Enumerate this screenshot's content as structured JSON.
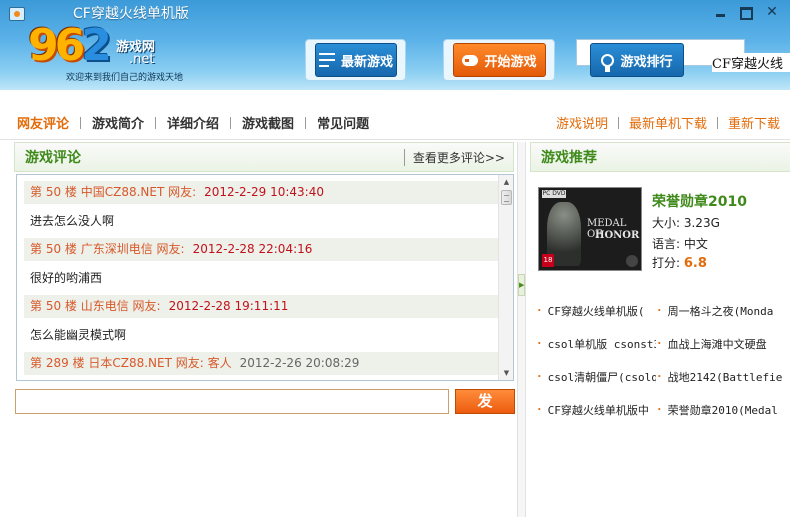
{
  "window": {
    "title": "CF穿越火线单机版"
  },
  "logo": {
    "digits": [
      "9",
      "6",
      "2"
    ],
    "brand_cn": "游戏网",
    "brand_suffix": ".net",
    "slogan": "欢迎来到我们自己的游戏天地"
  },
  "header_buttons": {
    "latest": "最新游戏",
    "start": "开始游戏",
    "ranking": "游戏排行"
  },
  "marquee_text": "CF穿越火线",
  "tabs": [
    "网友评论",
    "游戏简介",
    "详细介绍",
    "游戏截图",
    "常见问题"
  ],
  "links": [
    "游戏说明",
    "最新单机下载",
    "重新下载"
  ],
  "comments_section": {
    "title": "游戏评论",
    "more": "查看更多评论>>",
    "items": [
      {
        "header": "第 50 楼 中国CZ88.NET 网友:",
        "time": "2012-2-29 10:43:40",
        "body": "进去怎么没人啊"
      },
      {
        "header": "第 50 楼 广东深圳电信 网友:",
        "time": "2012-2-28 22:04:16",
        "body": "很好的哟浦西"
      },
      {
        "header": "第 50 楼 山东电信 网友:",
        "time": "2012-2-28 19:11:11",
        "body": "怎么能幽灵模式啊"
      },
      {
        "header": "第 289 楼 日本CZ88.NET 网友: 客人",
        "time": "2012-2-26 20:08:29",
        "body": ""
      }
    ]
  },
  "reply": {
    "value": "",
    "send_label": "发 送"
  },
  "recommend_section": {
    "title": "游戏推荐",
    "featured": {
      "name": "荣誉勋章2010",
      "size": "大小: 3.23G",
      "language": "语言: 中文",
      "score_label": "打分:",
      "score": "6.8",
      "cover_badge": "PC DVD",
      "cover_title_1": "MEDAL OF",
      "cover_title_2": "HONOR",
      "cover_rating": "18"
    },
    "list": [
      [
        "CF穿越火线单机版(",
        "周一格斗之夜(Monda"
      ],
      [
        "csol单机版 csonst3",
        "血战上海滩中文硬盘"
      ],
      [
        "csol清朝僵尸(csolq",
        "战地2142(Battlefie"
      ],
      [
        "CF穿越火线单机版中",
        "荣誉勋章2010(Medal"
      ]
    ]
  },
  "colors": {
    "accent_orange": "#e36c0a",
    "accent_green": "#3f8a1b",
    "header_blue": "#3c9ad8",
    "time_red": "#c1121c"
  }
}
